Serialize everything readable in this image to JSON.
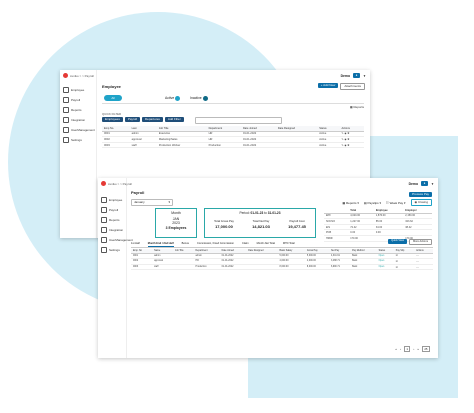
{
  "colors": {
    "bg_shape": "#d4eef7",
    "primary": "#0b6ea8",
    "accent_teal": "#2aa8a8",
    "dark_button": "#1f4e79",
    "pill_blue": "#1fa3c8",
    "pill_dark": "#0f6a86"
  },
  "sidebar": {
    "brand": "zeniko > > Payroll",
    "items": [
      {
        "label": "Employee",
        "icon": "users-icon"
      },
      {
        "label": "Payroll",
        "icon": "wallet-icon"
      },
      {
        "label": "Reports",
        "icon": "chart-icon"
      },
      {
        "label": "Integration",
        "icon": "plug-icon"
      },
      {
        "label": "UserManagement",
        "icon": "user-icon"
      },
      {
        "label": "Settings",
        "icon": "gear-icon"
      }
    ]
  },
  "win1": {
    "title": "Employee",
    "tabs": [
      "All",
      "Active",
      "Inactive"
    ],
    "top_buttons": [
      "+ Add New",
      "Attachments"
    ],
    "reports": "Reports",
    "quick_filter": "QUICK FILTER",
    "filter_buttons": [
      "Employees",
      "Payroll",
      "Departures",
      "Add Filter"
    ],
    "columns": [
      "Emp No.",
      "Last",
      "Job Title",
      "Department",
      "Date Joined",
      "Date Resigned",
      "Status",
      "Actions"
    ],
    "rows": [
      [
        "0001",
        "admin",
        "Executive",
        "HR",
        "01-01-2022",
        "",
        "Active"
      ],
      [
        "0002",
        "approval",
        "Marketing/Sales",
        "HR",
        "01-01-2022",
        "",
        "Active"
      ],
      [
        "0003",
        "staff",
        "Production Worker",
        "Production",
        "01-01-2022",
        "",
        "Active"
      ]
    ]
  },
  "win2": {
    "title": "Payroll",
    "user": "Demo",
    "process_pay": "Process Pay",
    "dropdown": "January",
    "toolbar": [
      "Reports",
      "Payslips",
      "Week Pay",
      "Closing"
    ],
    "month_card": {
      "label": "Month",
      "month": "JAN",
      "year": "2023",
      "employees": "3 Employees"
    },
    "period": {
      "label": "Period:",
      "from": "01-01-23",
      "sep": "to",
      "to": "31-01-23"
    },
    "totals": [
      {
        "label": "Total Gross Pay",
        "value": "17,000.00"
      },
      {
        "label": "Total Net Pay",
        "value": "14,821.03"
      },
      {
        "label": "Payroll Cost",
        "value": "19,477.45"
      }
    ],
    "side_table": {
      "headers": [
        "",
        "Total",
        "Employee",
        "Employer"
      ],
      "rows": [
        [
          "EPF",
          "4,020.00",
          "1,870.00",
          "2,150.00"
        ],
        [
          "SOCSO",
          "1,227.00",
          "85.00",
          "323.62"
        ],
        [
          "EIS",
          "72.42",
          "34.00",
          "38.42"
        ],
        [
          "PCB",
          "0.00",
          "0.00",
          ""
        ],
        [
          "HRDF",
          "170.00",
          "",
          "170.00"
        ]
      ]
    },
    "tabs": [
      "1st Half",
      "Month End / 2nd Half",
      "Bonus",
      "Commission, Fixed Commission",
      "Claim",
      "Month-Net Total",
      "MTD Total"
    ],
    "action_buttons": [
      "Quick View",
      "More Actions"
    ],
    "columns": [
      "Emp. No",
      "Name",
      "Job Title",
      "Department",
      "Date Joined",
      "Date Resigned",
      "Basic Salary",
      "Gross Pay",
      "Net Pay",
      "Pay Method",
      "Status",
      "Pay Slip",
      "Actions"
    ],
    "rows": [
      [
        "0001",
        "admin",
        "",
        "admin",
        "01-01-2022",
        "",
        "5,000.00",
        "5,000.00",
        "4,341.61",
        "Bank",
        "Open"
      ],
      [
        "0002",
        "approval",
        "",
        "HR",
        "01-01-2022",
        "",
        "4,000.00",
        "4,000.00",
        "3,488.71",
        "Bank",
        "Open"
      ],
      [
        "0003",
        "staff",
        "",
        "Production",
        "01-01-2022",
        "",
        "8,000.00",
        "8,000.00",
        "6,990.71",
        "Bank",
        "Open"
      ]
    ],
    "pagination": {
      "pages": "1",
      "rows_per_page": "25"
    }
  }
}
